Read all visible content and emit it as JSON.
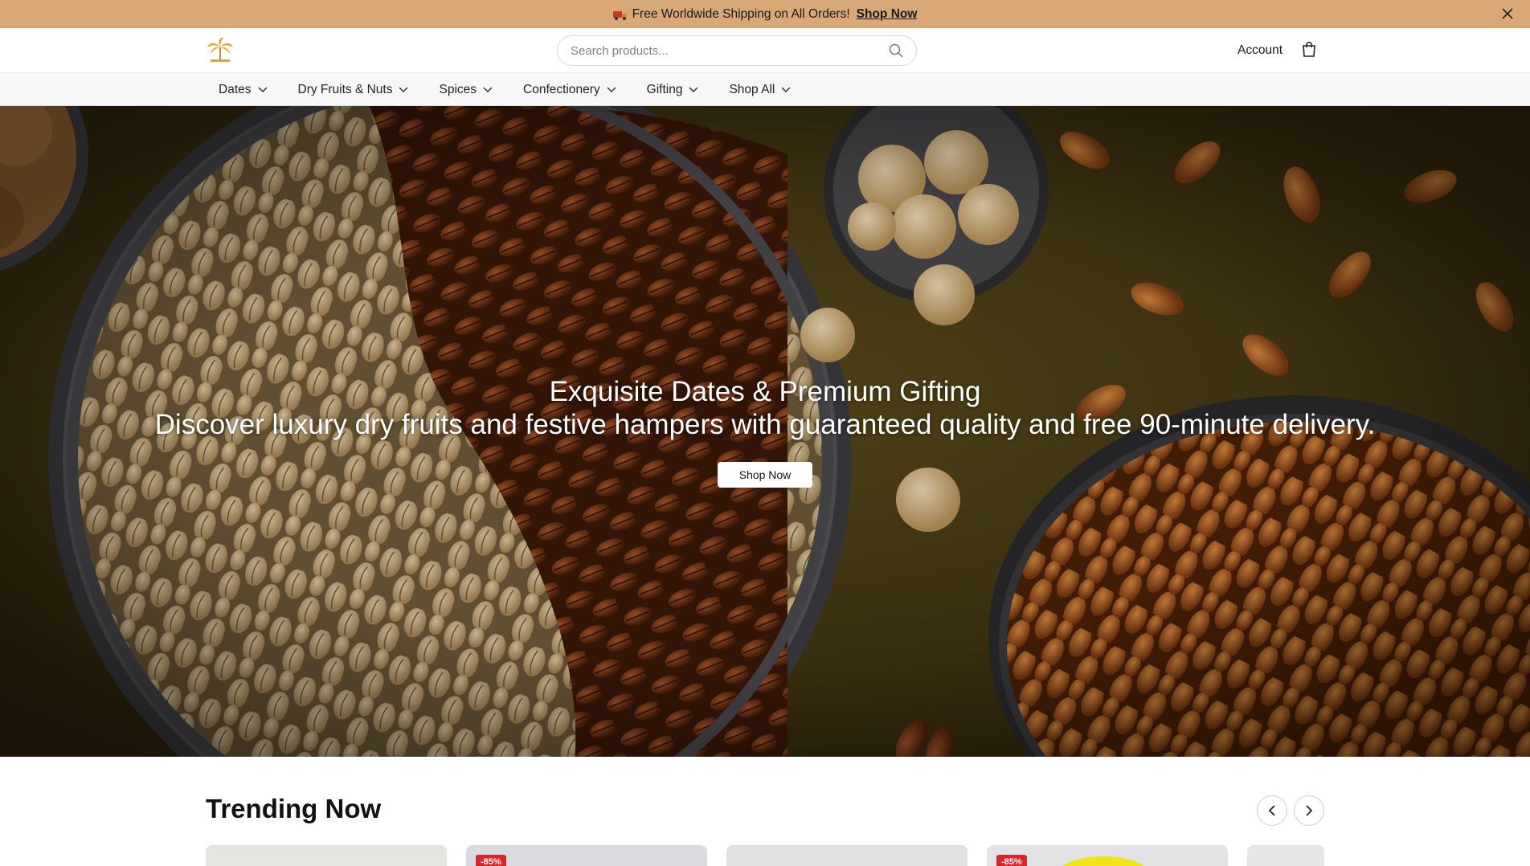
{
  "announcement": {
    "text": "Free Worldwide Shipping on All Orders!",
    "link_label": "Shop Now"
  },
  "header": {
    "search_placeholder": "Search products...",
    "account_label": "Account"
  },
  "nav": {
    "items": [
      {
        "label": "Dates"
      },
      {
        "label": "Dry Fruits & Nuts"
      },
      {
        "label": "Spices"
      },
      {
        "label": "Confectionery"
      },
      {
        "label": "Gifting"
      },
      {
        "label": "Shop All"
      }
    ]
  },
  "hero": {
    "title": "Exquisite Dates & Premium Gifting",
    "subtitle": "Discover luxury dry fruits and festive hampers with guaranteed quality and free 90-minute delivery.",
    "button_label": "Shop Now"
  },
  "trending": {
    "title": "Trending Now",
    "cards": [
      {
        "badge": ""
      },
      {
        "badge": "-85%"
      },
      {
        "badge": ""
      },
      {
        "badge": "-85%"
      },
      {
        "badge": ""
      }
    ]
  },
  "colors": {
    "announcement_bg": "#d9a877",
    "nav_bg": "#f7f7f8",
    "sale_badge": "#d62828"
  },
  "icons": [
    "truck-icon",
    "close-icon",
    "logo-palm-icon",
    "search-icon",
    "cart-icon",
    "chevron-down-icon",
    "chevron-left-icon",
    "chevron-right-icon"
  ]
}
